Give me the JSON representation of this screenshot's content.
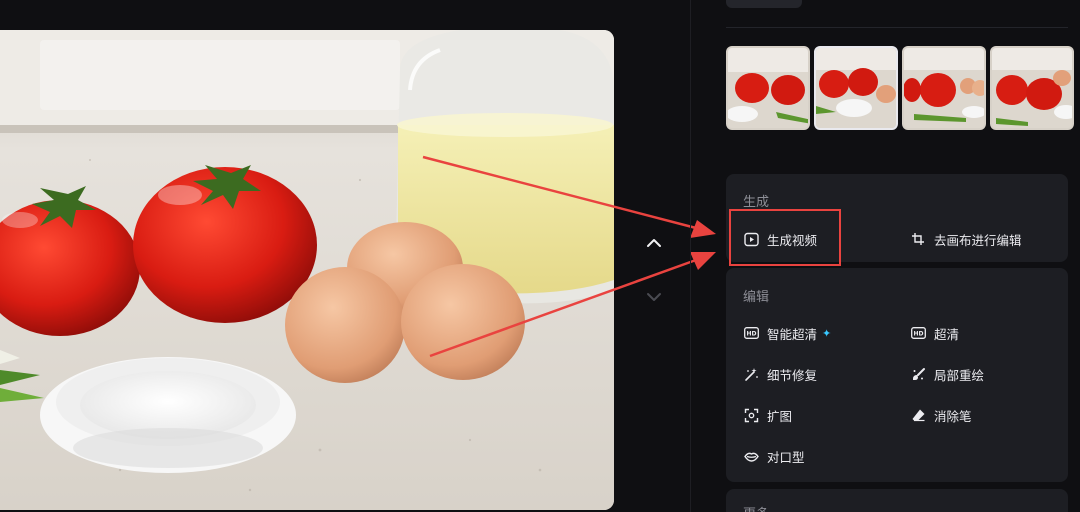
{
  "thumbnails": [
    {
      "name": "variant-1"
    },
    {
      "name": "variant-2",
      "selected": true
    },
    {
      "name": "variant-3"
    },
    {
      "name": "variant-4"
    }
  ],
  "generate": {
    "title": "生成",
    "video_label": "生成视频",
    "canvas_label": "去画布进行编辑"
  },
  "edit": {
    "title": "编辑",
    "smart_hd_label": "智能超清",
    "hd_label": "超清",
    "detail_fix_label": "细节修复",
    "local_redraw_label": "局部重绘",
    "expand_label": "扩图",
    "eraser_label": "消除笔",
    "lip_sync_label": "对口型"
  },
  "more": {
    "title": "更多"
  },
  "icons": {
    "video": "play-square-icon",
    "canvas": "crop-icon",
    "smart_hd": "hd-badge-icon",
    "hd": "hd-badge-icon",
    "detail_fix": "magic-wand-icon",
    "local_redraw": "brush-icon",
    "expand": "expand-icon",
    "eraser": "eraser-icon",
    "lip_sync": "lips-icon",
    "sparkle": "sparkle-icon"
  },
  "colors": {
    "background": "#0f0f12",
    "card": "#1d1e23",
    "highlight": "#e9433f",
    "sparkle": "#39c8ff"
  }
}
